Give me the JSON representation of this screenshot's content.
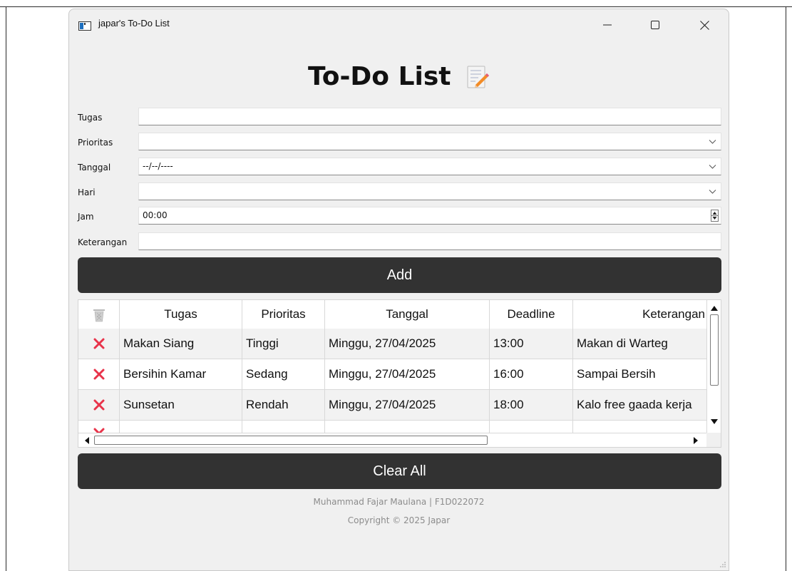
{
  "window": {
    "title": "japar's To-Do List"
  },
  "header": {
    "title": "To-Do List",
    "icon": "memo-icon"
  },
  "form": {
    "tugas_label": "Tugas",
    "tugas_value": "",
    "prioritas_label": "Prioritas",
    "prioritas_value": "",
    "tanggal_label": "Tanggal",
    "tanggal_value": "--/--/----",
    "hari_label": "Hari",
    "hari_value": "",
    "jam_label": "Jam",
    "jam_value": "00:00",
    "keterangan_label": "Keterangan",
    "keterangan_value": ""
  },
  "buttons": {
    "add": "Add",
    "clear_all": "Clear All"
  },
  "table": {
    "columns": [
      "Tugas",
      "Prioritas",
      "Tanggal",
      "Deadline",
      "Keterangan"
    ],
    "rows": [
      [
        "Makan Siang",
        "Tinggi",
        "Minggu, 27/04/2025",
        "13:00",
        "Makan di Warteg"
      ],
      [
        "Bersihin Kamar",
        "Sedang",
        "Minggu, 27/04/2025",
        "16:00",
        "Sampai Bersih"
      ],
      [
        "Sunsetan",
        "Rendah",
        "Minggu, 27/04/2025",
        "18:00",
        "Kalo free gaada kerja"
      ]
    ]
  },
  "footer": {
    "author": "Muhammad Fajar Maulana | F1D022072",
    "copyright": "Copyright © 2025 Japar"
  },
  "colors": {
    "button_bg": "#323232",
    "delete_icon": "#e8334a",
    "window_bg": "#f0f0f0"
  }
}
